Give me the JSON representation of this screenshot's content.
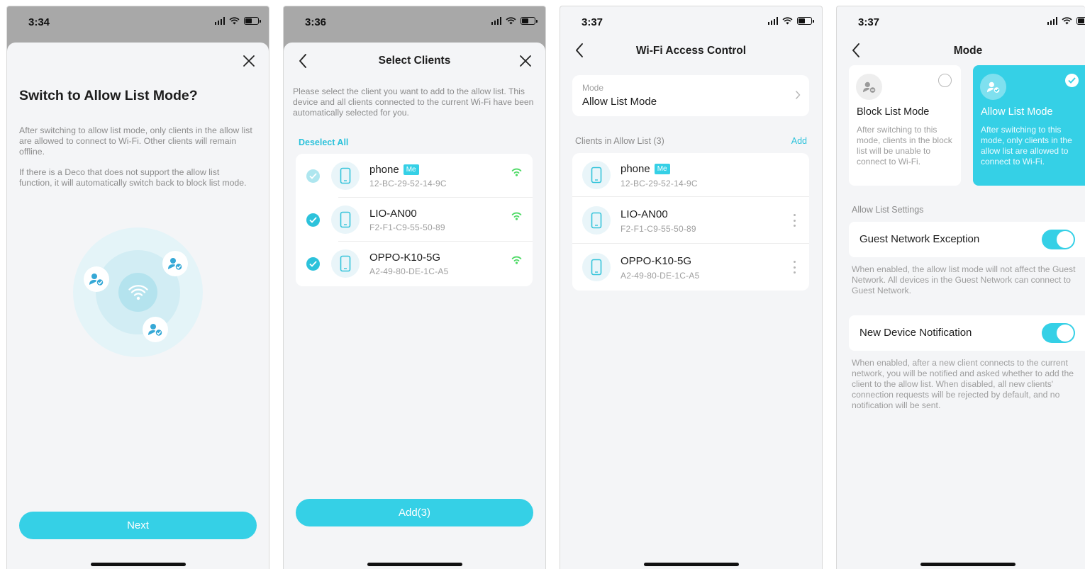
{
  "colors": {
    "accent": "#35d0e6",
    "accent_text": "#2cc2db",
    "wifi_green": "#4cd964",
    "dim_overlay": "#a8a8a8",
    "background": "#f4f5f7"
  },
  "screen1": {
    "time": "3:34",
    "title": "Switch to Allow List Mode?",
    "para1": "After switching to allow list mode, only clients in the allow list are allowed to connect to Wi-Fi. Other clients will remain offline.",
    "para2": "If there is a Deco that does not support the allow list function, it will automatically switch back to block list mode.",
    "next_label": "Next",
    "icons": [
      "close-icon",
      "wifi-icon",
      "user-check-icon"
    ]
  },
  "screen2": {
    "time": "3:36",
    "title": "Select Clients",
    "instruction": "Please select the client you want to add to the allow list. This device and all clients connected to the current Wi-Fi have been automatically selected for you.",
    "deselect_all": "Deselect All",
    "clients": [
      {
        "name": "phone",
        "badge": "Me",
        "mac": "12-BC-29-52-14-9C",
        "checked": true,
        "locked": true
      },
      {
        "name": "LIO-AN00",
        "badge": "",
        "mac": "F2-F1-C9-55-50-89",
        "checked": true,
        "locked": false
      },
      {
        "name": "OPPO-K10-5G",
        "badge": "",
        "mac": "A2-49-80-DE-1C-A5",
        "checked": true,
        "locked": false
      }
    ],
    "add_label": "Add(3)"
  },
  "screen3": {
    "time": "3:37",
    "title": "Wi-Fi Access Control",
    "mode_label": "Mode",
    "mode_value": "Allow List Mode",
    "list_header": "Clients in Allow List (3)",
    "add_link": "Add",
    "clients": [
      {
        "name": "phone",
        "badge": "Me",
        "mac": "12-BC-29-52-14-9C"
      },
      {
        "name": "LIO-AN00",
        "badge": "",
        "mac": "F2-F1-C9-55-50-89"
      },
      {
        "name": "OPPO-K10-5G",
        "badge": "",
        "mac": "A2-49-80-DE-1C-A5"
      }
    ]
  },
  "screen4": {
    "time": "3:37",
    "title": "Mode",
    "block_mode": {
      "title": "Block List Mode",
      "desc": "After switching to this mode, clients in the block list will be unable to connect to Wi-Fi.",
      "selected": false
    },
    "allow_mode": {
      "title": "Allow List Mode",
      "desc": "After switching to this mode, only clients in the allow list are allowed to connect to Wi-Fi.",
      "selected": true
    },
    "settings_header": "Allow List Settings",
    "guest_label": "Guest Network Exception",
    "guest_on": true,
    "guest_note": "When enabled, the allow list mode will not affect the Guest Network. All devices in the Guest Network can connect to Guest Network.",
    "notify_label": "New Device Notification",
    "notify_on": true,
    "notify_note": "When enabled, after a new client connects to the current network, you will be notified and asked whether to add the client to the allow list. When disabled, all new clients' connection requests will be rejected by default, and no notification will be sent."
  }
}
